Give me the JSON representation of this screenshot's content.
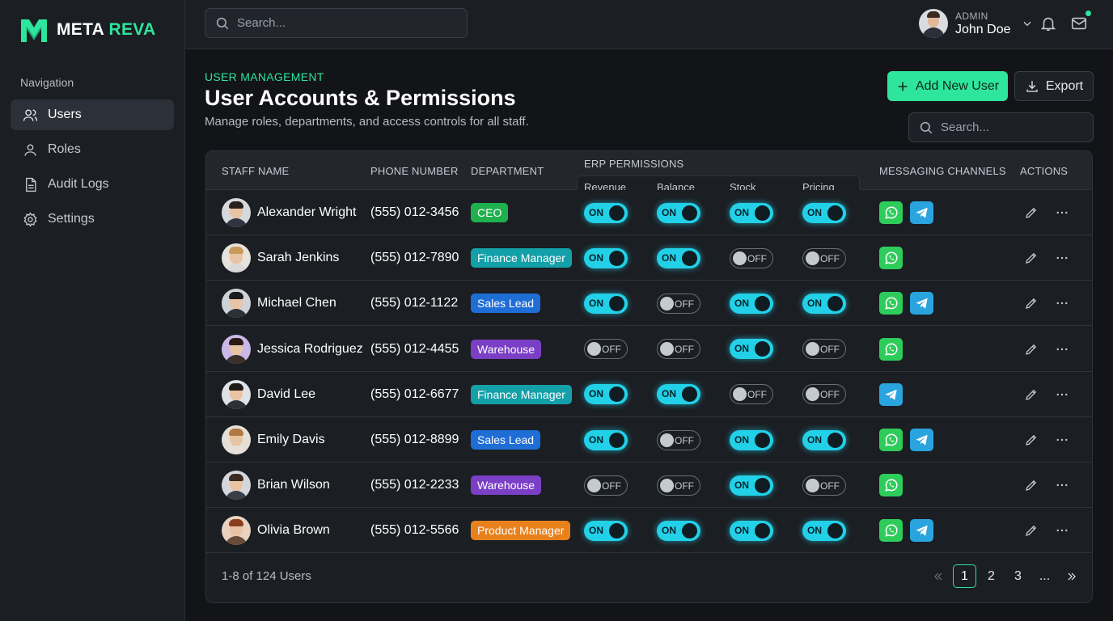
{
  "brand": {
    "name_a": "META",
    "name_b": "REVA",
    "accent": "#2ee59d"
  },
  "nav": {
    "heading": "Navigation",
    "items": [
      {
        "label": "Users",
        "icon": "users-icon",
        "active": true
      },
      {
        "label": "Roles",
        "icon": "user-icon",
        "active": false
      },
      {
        "label": "Audit Logs",
        "icon": "document-icon",
        "active": false
      },
      {
        "label": "Settings",
        "icon": "gear-icon",
        "active": false
      }
    ]
  },
  "topbar": {
    "search_placeholder": "Search...",
    "user_role": "ADMIN",
    "user_name": "John Doe"
  },
  "page": {
    "eyebrow": "USER MANAGEMENT",
    "title": "User Accounts & Permissions",
    "subtitle": "Manage roles, departments, and access controls for all staff.",
    "add_button": "Add New User",
    "export_button": "Export",
    "search_placeholder": "Search..."
  },
  "table": {
    "headers": {
      "staff": "STAFF NAME",
      "phone": "PHONE NUMBER",
      "department": "DEPARTMENT",
      "erp": "ERP PERMISSIONS",
      "messaging": "MESSAGING CHANNELS",
      "actions": "ACTIONS"
    },
    "erp_columns": [
      "Revenue",
      "Balance",
      "Stock",
      "Pricing"
    ],
    "toggle_on": "ON",
    "toggle_off": "OFF",
    "rows": [
      {
        "name": "Alexander Wright",
        "phone": "(555) 012-3456",
        "department": "CEO",
        "dept_color": "#1fb14e",
        "perms": [
          true,
          true,
          true,
          true
        ],
        "whatsapp": true,
        "telegram": true
      },
      {
        "name": "Sarah Jenkins",
        "phone": "(555) 012-7890",
        "department": "Finance Manager",
        "dept_color": "#14a0a8",
        "perms": [
          true,
          true,
          false,
          false
        ],
        "whatsapp": true,
        "telegram": false
      },
      {
        "name": "Michael Chen",
        "phone": "(555) 012-1122",
        "department": "Sales Lead",
        "dept_color": "#1f6ed6",
        "perms": [
          true,
          false,
          true,
          true
        ],
        "whatsapp": true,
        "telegram": true
      },
      {
        "name": "Jessica Rodriguez",
        "phone": "(555) 012-4455",
        "department": "Warehouse",
        "dept_color": "#7a3fc4",
        "perms": [
          false,
          false,
          true,
          false
        ],
        "whatsapp": true,
        "telegram": false
      },
      {
        "name": "David Lee",
        "phone": "(555) 012-6677",
        "department": "Finance Manager",
        "dept_color": "#14a0a8",
        "perms": [
          true,
          true,
          false,
          false
        ],
        "whatsapp": false,
        "telegram": true
      },
      {
        "name": "Emily Davis",
        "phone": "(555) 012-8899",
        "department": "Sales Lead",
        "dept_color": "#1f6ed6",
        "perms": [
          true,
          false,
          true,
          true
        ],
        "whatsapp": true,
        "telegram": true
      },
      {
        "name": "Brian Wilson",
        "phone": "(555) 012-2233",
        "department": "Warehouse",
        "dept_color": "#7a3fc4",
        "perms": [
          false,
          false,
          true,
          false
        ],
        "whatsapp": true,
        "telegram": false
      },
      {
        "name": "Olivia Brown",
        "phone": "(555) 012-5566",
        "department": "Product Manager",
        "dept_color": "#e8811c",
        "perms": [
          true,
          true,
          true,
          true
        ],
        "whatsapp": true,
        "telegram": true
      }
    ]
  },
  "footer": {
    "count": "1-8 of 124 Users",
    "pages": [
      "1",
      "2",
      "3",
      "..."
    ],
    "current_page": "1"
  }
}
